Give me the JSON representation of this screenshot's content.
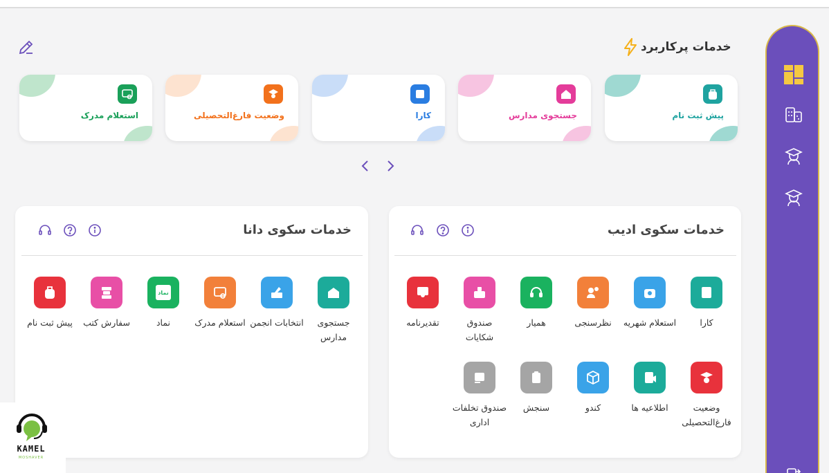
{
  "header": {
    "title": "خدمات پرکاربرد"
  },
  "top_cards": [
    {
      "label": "پیش ثبت نام",
      "color": "#1fa3a0",
      "blob": "#9fd9d2",
      "icon": "backpack-icon"
    },
    {
      "label": "جستجوی مدارس",
      "color": "#e43c9a",
      "blob": "#f7c4e1",
      "icon": "school-icon"
    },
    {
      "label": "کارا",
      "color": "#2a7de1",
      "blob": "#c9ddf8",
      "icon": "kara-icon"
    },
    {
      "label": "وضعیت فارغ‌التحصیلی",
      "color": "#f2711c",
      "blob": "#fde3d0",
      "icon": "graduate-icon"
    },
    {
      "label": "استعلام مدرک",
      "color": "#1aa059",
      "blob": "#bfe5cc",
      "icon": "certificate-icon"
    }
  ],
  "panel_adib": {
    "title": "خدمات سکوی ادیب",
    "items": [
      {
        "label": "کارا",
        "color": "#1cab9a",
        "icon": "kara-icon"
      },
      {
        "label": "استعلام شهریه",
        "color": "#3aa3e8",
        "icon": "tuition-icon"
      },
      {
        "label": "نظرسنجی",
        "color": "#f2803a",
        "icon": "survey-icon"
      },
      {
        "label": "همیار",
        "color": "#1ab25f",
        "icon": "headset-icon"
      },
      {
        "label": "صندوق شکایات",
        "color": "#e84fa6",
        "icon": "complaint-box-icon"
      },
      {
        "label": "تقدیرنامه",
        "color": "#e8323c",
        "icon": "award-icon"
      },
      {
        "label": "وضعیت فارغ‌التحصیلی",
        "color": "#e8323c",
        "icon": "graduate-icon"
      },
      {
        "label": "اطلاعیه ها",
        "color": "#1cab9a",
        "icon": "announce-icon"
      },
      {
        "label": "کندو",
        "color": "#3aa3e8",
        "icon": "hive-icon"
      },
      {
        "label": "سنجش",
        "color": "#a5a5a5",
        "icon": "assessment-icon"
      },
      {
        "label": "صندوق تخلفات اداری",
        "color": "#a5a5a5",
        "icon": "violation-box-icon"
      }
    ]
  },
  "panel_dana": {
    "title": "خدمات سکوی دانا",
    "items": [
      {
        "label": "جستجوی مدارس",
        "color": "#1cab9a",
        "icon": "school-icon"
      },
      {
        "label": "انتخابات انجمن",
        "color": "#3aa3e8",
        "icon": "ballot-icon"
      },
      {
        "label": "استعلام مدرک",
        "color": "#f2803a",
        "icon": "certificate-icon"
      },
      {
        "label": "نماد",
        "color": "#1ab25f",
        "icon": "namad-icon"
      },
      {
        "label": "سفارش کتب",
        "color": "#e84fa6",
        "icon": "books-icon"
      },
      {
        "label": "پیش ثبت نام",
        "color": "#e8323c",
        "icon": "backpack-icon"
      }
    ]
  },
  "icon_badge": "نماد",
  "kamel": {
    "name": "KAMEL",
    "sub": "MOSHAVER"
  },
  "colors": {
    "sidebar": "#6b4fbb",
    "accent": "#6b4fbb"
  }
}
